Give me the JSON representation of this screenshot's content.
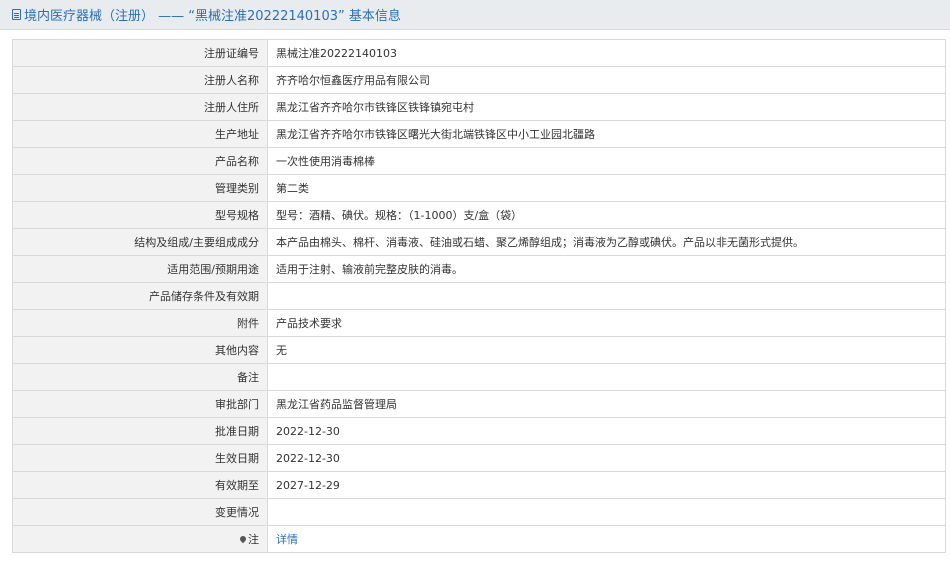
{
  "title": {
    "text": "境内医疗器械（注册） —— “黑械注准20222140103” 基本信息"
  },
  "rows": [
    {
      "label": "注册证编号",
      "value": "黑械注准20222140103"
    },
    {
      "label": "注册人名称",
      "value": "齐齐哈尔恒鑫医疗用品有限公司"
    },
    {
      "label": "注册人住所",
      "value": "黑龙江省齐齐哈尔市铁锋区铁锋镇宛屯村"
    },
    {
      "label": "生产地址",
      "value": "黑龙江省齐齐哈尔市铁锋区曙光大街北端铁锋区中小工业园北疆路"
    },
    {
      "label": "产品名称",
      "value": "一次性使用消毒棉棒"
    },
    {
      "label": "管理类别",
      "value": "第二类"
    },
    {
      "label": "型号规格",
      "value": "型号：酒精、碘伏。规格：（1-1000）支/盒（袋）"
    },
    {
      "label": "结构及组成/主要组成成分",
      "value": "本产品由棉头、棉杆、消毒液、硅油或石蜡、聚乙烯醇组成；消毒液为乙醇或碘伏。产品以非无菌形式提供。"
    },
    {
      "label": "适用范围/预期用途",
      "value": "适用于注射、输液前完整皮肤的消毒。"
    },
    {
      "label": "产品储存条件及有效期",
      "value": ""
    },
    {
      "label": "附件",
      "value": "产品技术要求"
    },
    {
      "label": "其他内容",
      "value": "无"
    },
    {
      "label": "备注",
      "value": ""
    },
    {
      "label": "审批部门",
      "value": "黑龙江省药品监督管理局"
    },
    {
      "label": "批准日期",
      "value": "2022-12-30"
    },
    {
      "label": "生效日期",
      "value": "2022-12-30"
    },
    {
      "label": "有效期至",
      "value": "2027-12-29"
    },
    {
      "label": "变更情况",
      "value": ""
    }
  ],
  "note_row": {
    "icon": "pin-icon",
    "label": "注",
    "link_text": "详情"
  }
}
